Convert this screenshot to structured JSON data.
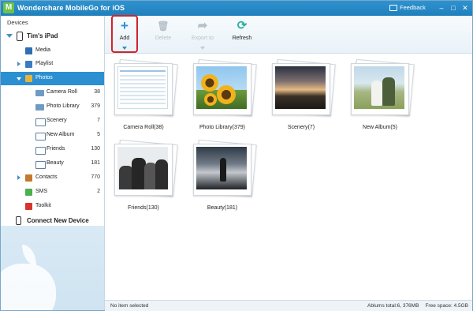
{
  "window": {
    "title": "Wondershare MobileGo for iOS",
    "logo_letter": "M",
    "feedback_label": "Feedback",
    "controls": [
      "–",
      "□",
      "✕"
    ]
  },
  "sidebar": {
    "header": "Devices",
    "device_name": "Tim's iPad",
    "items": [
      {
        "label": "Media",
        "icon": "media-icon",
        "color": "#2d6fb3"
      },
      {
        "label": "Playlist",
        "icon": "playlist-icon",
        "color": "#3a7cc2"
      },
      {
        "label": "Photos",
        "icon": "photos-icon",
        "color": "#e8b33a",
        "selected": true
      },
      {
        "label": "Contacts",
        "count": "770",
        "icon": "contacts-icon",
        "color": "#c47a2c"
      },
      {
        "label": "SMS",
        "count": "2",
        "icon": "sms-icon",
        "color": "#4caf50"
      },
      {
        "label": "Toolkit",
        "icon": "toolkit-icon",
        "color": "#d9342b"
      }
    ],
    "albums": [
      {
        "label": "Camera Roll",
        "count": "38",
        "icon": "folder-icon"
      },
      {
        "label": "Photo Library",
        "count": "379",
        "icon": "folder-icon"
      },
      {
        "label": "Scenery",
        "count": "7",
        "icon": "album-icon"
      },
      {
        "label": "New Album",
        "count": "5",
        "icon": "album-icon"
      },
      {
        "label": "Friends",
        "count": "130",
        "icon": "album-icon"
      },
      {
        "label": "Beauty",
        "count": "181",
        "icon": "album-icon"
      }
    ],
    "connect_label": "Connect New Device"
  },
  "toolbar": {
    "add_label": "Add",
    "delete_label": "Delete",
    "export_label": "Export to",
    "refresh_label": "Refresh"
  },
  "albums_grid": [
    {
      "label": "Camera Roll(38)"
    },
    {
      "label": "Photo Library(379)"
    },
    {
      "label": "Scenery(7)"
    },
    {
      "label": "New Album(5)"
    },
    {
      "label": "Friends(130)"
    },
    {
      "label": "Beauty(181)"
    }
  ],
  "status": {
    "selection": "No item selected",
    "totals": "Ablums total:6, 376MB",
    "free_space": "Free space: 4.5GB"
  },
  "colors": {
    "accent": "#2b8fd1",
    "highlight": "#d2232a",
    "title_bar": "#1f7fbc"
  }
}
